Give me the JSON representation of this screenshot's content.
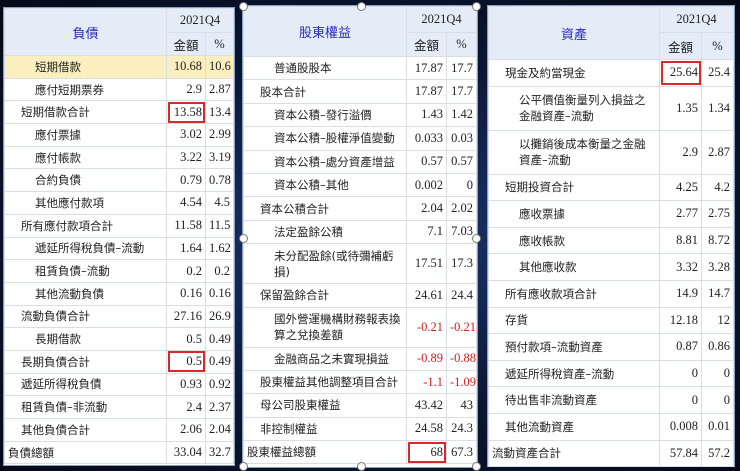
{
  "liabilities": {
    "title": "負債",
    "period": "2021Q4",
    "col_amount": "金額",
    "col_pct": "%",
    "rows": [
      {
        "label": "短期借款",
        "amount": "10.68",
        "pct": "10.6",
        "indent": 2,
        "highlight_row": true
      },
      {
        "label": "應付短期票券",
        "amount": "2.9",
        "pct": "2.87",
        "indent": 2
      },
      {
        "label": "短期借款合計",
        "amount": "13.58",
        "pct": "13.4",
        "indent": 1,
        "boxed": true
      },
      {
        "label": "應付票據",
        "amount": "3.02",
        "pct": "2.99",
        "indent": 2
      },
      {
        "label": "應付帳款",
        "amount": "3.22",
        "pct": "3.19",
        "indent": 2
      },
      {
        "label": "合約負債",
        "amount": "0.79",
        "pct": "0.78",
        "indent": 2
      },
      {
        "label": "其他應付款項",
        "amount": "4.54",
        "pct": "4.5",
        "indent": 2
      },
      {
        "label": "所有應付款項合計",
        "amount": "11.58",
        "pct": "11.5",
        "indent": 1
      },
      {
        "label": "遞延所得稅負債–流動",
        "amount": "1.64",
        "pct": "1.62",
        "indent": 2
      },
      {
        "label": "租賃負債–流動",
        "amount": "0.2",
        "pct": "0.2",
        "indent": 2
      },
      {
        "label": "其他流動負債",
        "amount": "0.16",
        "pct": "0.16",
        "indent": 2
      },
      {
        "label": "流動負債合計",
        "amount": "27.16",
        "pct": "26.9",
        "indent": 1
      },
      {
        "label": "長期借款",
        "amount": "0.5",
        "pct": "0.49",
        "indent": 2
      },
      {
        "label": "長期負債合計",
        "amount": "0.5",
        "pct": "0.49",
        "indent": 1,
        "boxed": true
      },
      {
        "label": "遞延所得稅負債",
        "amount": "0.93",
        "pct": "0.92",
        "indent": 1
      },
      {
        "label": "租賃負債–非流動",
        "amount": "2.4",
        "pct": "2.37",
        "indent": 1
      },
      {
        "label": "其他負債合計",
        "amount": "2.06",
        "pct": "2.04",
        "indent": 1
      },
      {
        "label": "負債總額",
        "amount": "33.04",
        "pct": "32.7",
        "indent": 0
      }
    ]
  },
  "equity": {
    "title": "股東權益",
    "period": "2021Q4",
    "col_amount": "金額",
    "col_pct": "%",
    "rows": [
      {
        "label": "普通股股本",
        "amount": "17.87",
        "pct": "17.7",
        "indent": 2
      },
      {
        "label": "股本合計",
        "amount": "17.87",
        "pct": "17.7",
        "indent": 1
      },
      {
        "label": "資本公積–發行溢價",
        "amount": "1.43",
        "pct": "1.42",
        "indent": 2
      },
      {
        "label": "資本公積–股權淨值變動",
        "amount": "0.033",
        "pct": "0.03",
        "indent": 2
      },
      {
        "label": "資本公積–處分資產增益",
        "amount": "0.57",
        "pct": "0.57",
        "indent": 2
      },
      {
        "label": "資本公積–其他",
        "amount": "0.002",
        "pct": "0",
        "indent": 2
      },
      {
        "label": "資本公積合計",
        "amount": "2.04",
        "pct": "2.02",
        "indent": 1
      },
      {
        "label": "法定盈餘公積",
        "amount": "7.1",
        "pct": "7.03",
        "indent": 2
      },
      {
        "label": "未分配盈餘(或待彌補虧損)",
        "amount": "17.51",
        "pct": "17.3",
        "indent": 2,
        "tall": true
      },
      {
        "label": "保留盈餘合計",
        "amount": "24.61",
        "pct": "24.4",
        "indent": 1
      },
      {
        "label": "國外營運機構財務報表換算之兌換差額",
        "amount": "-0.21",
        "pct": "-0.21",
        "indent": 2,
        "tall": true,
        "negative": true
      },
      {
        "label": "金融商品之未實現損益",
        "amount": "-0.89",
        "pct": "-0.88",
        "indent": 2,
        "negative": true
      },
      {
        "label": "股東權益其他調整項目合計",
        "amount": "-1.1",
        "pct": "-1.09",
        "indent": 1,
        "negative": true
      },
      {
        "label": "母公司股東權益",
        "amount": "43.42",
        "pct": "43",
        "indent": 1
      },
      {
        "label": "非控制權益",
        "amount": "24.58",
        "pct": "24.3",
        "indent": 1
      },
      {
        "label": "股東權益總額",
        "amount": "68",
        "pct": "67.3",
        "indent": 0,
        "boxed": true
      }
    ]
  },
  "assets": {
    "title": "資產",
    "period": "2021Q4",
    "col_amount": "金額",
    "col_pct": "%",
    "rows": [
      {
        "label": "現金及約當現金",
        "amount": "25.64",
        "pct": "25.4",
        "indent": 1,
        "boxed": true
      },
      {
        "label": "公平價值衡量列入損益之金融資產–流動",
        "amount": "1.35",
        "pct": "1.34",
        "indent": 2,
        "tall": true
      },
      {
        "label": "以攤銷後成本衡量之金融資產–流動",
        "amount": "2.9",
        "pct": "2.87",
        "indent": 2,
        "tall": true
      },
      {
        "label": "短期投資合計",
        "amount": "4.25",
        "pct": "4.2",
        "indent": 1
      },
      {
        "label": "應收票據",
        "amount": "2.77",
        "pct": "2.75",
        "indent": 2
      },
      {
        "label": "應收帳款",
        "amount": "8.81",
        "pct": "8.72",
        "indent": 2
      },
      {
        "label": "其他應收款",
        "amount": "3.32",
        "pct": "3.28",
        "indent": 2
      },
      {
        "label": "所有應收款項合計",
        "amount": "14.9",
        "pct": "14.7",
        "indent": 1
      },
      {
        "label": "存貨",
        "amount": "12.18",
        "pct": "12",
        "indent": 1
      },
      {
        "label": "預付款項–流動資產",
        "amount": "0.87",
        "pct": "0.86",
        "indent": 1
      },
      {
        "label": "遞延所得稅資產–流動",
        "amount": "0",
        "pct": "0",
        "indent": 1
      },
      {
        "label": "待出售非流動資產",
        "amount": "0",
        "pct": "0",
        "indent": 1
      },
      {
        "label": "其他流動資產",
        "amount": "0.008",
        "pct": "0.01",
        "indent": 1
      },
      {
        "label": "流動資產合計",
        "amount": "57.84",
        "pct": "57.2",
        "indent": 0
      }
    ]
  }
}
